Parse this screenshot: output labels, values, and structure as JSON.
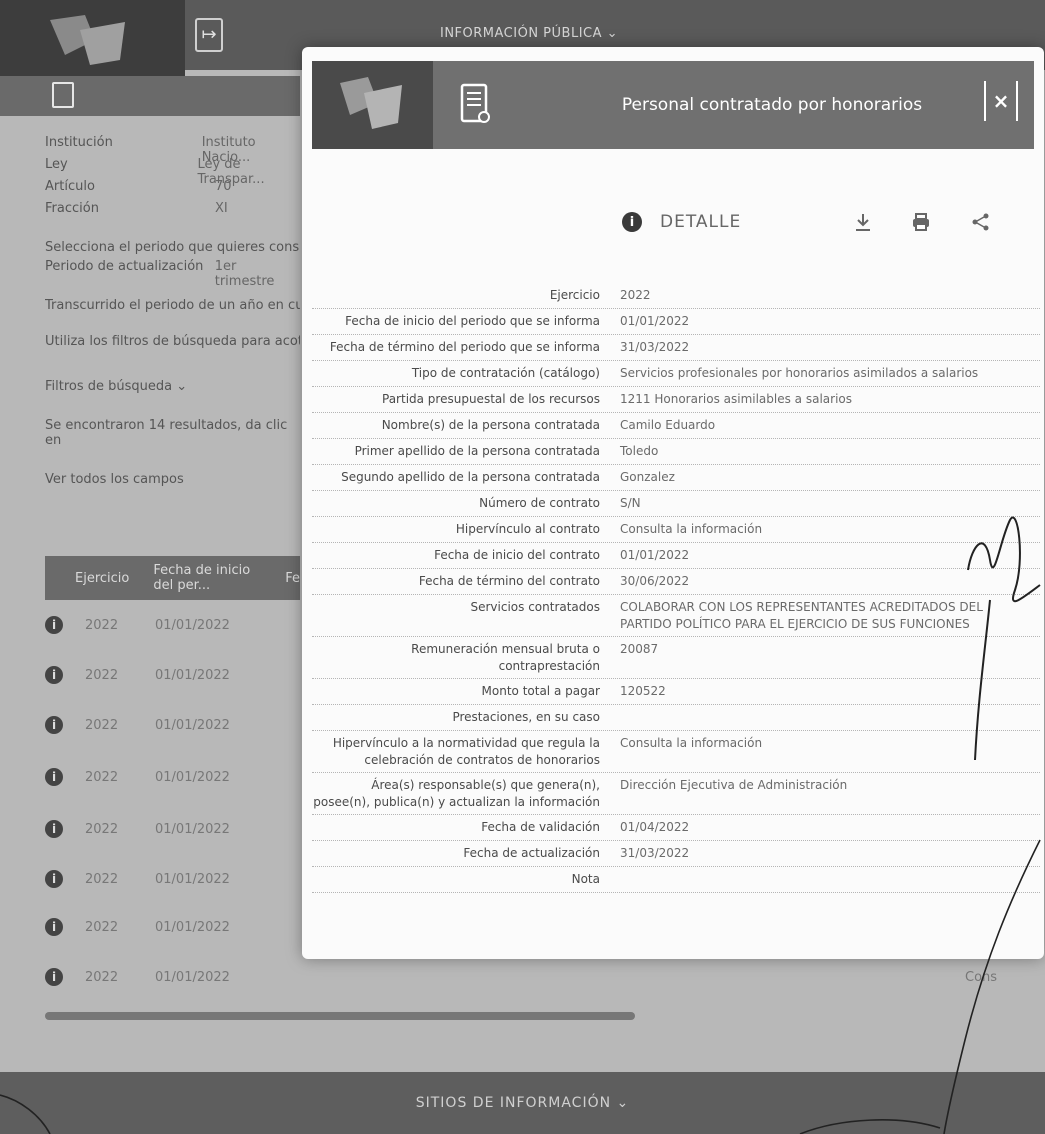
{
  "top_nav": {
    "menu_label": "INFORMACIÓN PÚBLICA ⌄"
  },
  "background": {
    "fields": [
      {
        "label": "Institución",
        "value": "Instituto Nacio..."
      },
      {
        "label": "Ley",
        "value": "Ley de Transpar..."
      },
      {
        "label": "Artículo",
        "value": "70"
      },
      {
        "label": "Fracción",
        "value": "XI"
      }
    ],
    "period_prompt": "Selecciona el periodo que quieres consultar",
    "period_label": "Periodo de actualización",
    "period_value": "1er trimestre",
    "note_1": "Transcurrido el periodo de un año en curso y de...",
    "note_2": "Utiliza los filtros de búsqueda para acotar tu...",
    "filters_label": "Filtros de búsqueda ⌄",
    "results_text": "Se encontraron 14 resultados, da clic en",
    "view_all": "Ver todos los campos",
    "table_headers": [
      "Ejercicio",
      "Fecha de inicio del per...",
      "Fe"
    ],
    "rows": [
      {
        "year": "2022",
        "date": "01/01/2022",
        "extra": ""
      },
      {
        "year": "2022",
        "date": "01/01/2022",
        "extra": ""
      },
      {
        "year": "2022",
        "date": "01/01/2022",
        "extra": ""
      },
      {
        "year": "2022",
        "date": "01/01/2022",
        "extra": ""
      },
      {
        "year": "2022",
        "date": "01/01/2022",
        "extra": ""
      },
      {
        "year": "2022",
        "date": "01/01/2022",
        "extra": ""
      },
      {
        "year": "2022",
        "date": "01/01/2022",
        "extra": ""
      },
      {
        "year": "2022",
        "date": "01/01/2022",
        "extra": "Cons"
      }
    ],
    "footer_label": "SITIOS DE INFORMACIÓN ⌄"
  },
  "modal": {
    "title": "Personal contratado por honorarios",
    "close_label": "×",
    "detail_label": "DETALLE",
    "info_glyph": "i",
    "icons": [
      "download-icon",
      "print-icon",
      "share-icon"
    ],
    "rows": [
      {
        "label": "Ejercicio",
        "value": "2022"
      },
      {
        "label": "Fecha de inicio del periodo que se informa",
        "value": "01/01/2022"
      },
      {
        "label": "Fecha de término del periodo que se informa",
        "value": "31/03/2022"
      },
      {
        "label": "Tipo de contratación (catálogo)",
        "value": "Servicios profesionales por honorarios asimilados a salarios"
      },
      {
        "label": "Partida presupuestal de los recursos",
        "value": "1211 Honorarios asimilables a salarios"
      },
      {
        "label": "Nombre(s) de la persona contratada",
        "value": "Camilo Eduardo"
      },
      {
        "label": "Primer apellido de la persona contratada",
        "value": "Toledo"
      },
      {
        "label": "Segundo apellido de la persona contratada",
        "value": "Gonzalez"
      },
      {
        "label": "Número de contrato",
        "value": "S/N"
      },
      {
        "label": "Hipervínculo al contrato",
        "value": "Consulta la información"
      },
      {
        "label": "Fecha de inicio del contrato",
        "value": "01/01/2022"
      },
      {
        "label": "Fecha de término del contrato",
        "value": "30/06/2022"
      },
      {
        "label": "Servicios contratados",
        "value": "COLABORAR CON LOS REPRESENTANTES ACREDITADOS DEL PARTIDO POLÍTICO PARA EL EJERCICIO DE SUS FUNCIONES"
      },
      {
        "label": "Remuneración mensual bruta o contraprestación",
        "value": "20087"
      },
      {
        "label": "Monto total a pagar",
        "value": "120522"
      },
      {
        "label": "Prestaciones, en su caso",
        "value": ""
      },
      {
        "label": "Hipervínculo a la normatividad que regula la celebración de contratos de honorarios",
        "value": "Consulta la información"
      },
      {
        "label": "Área(s) responsable(s) que genera(n), posee(n), publica(n) y actualizan la información",
        "value": "Dirección Ejecutiva de Administración"
      },
      {
        "label": "Fecha de validación",
        "value": "01/04/2022"
      },
      {
        "label": "Fecha de actualización",
        "value": "31/03/2022"
      },
      {
        "label": "Nota",
        "value": ""
      }
    ]
  }
}
